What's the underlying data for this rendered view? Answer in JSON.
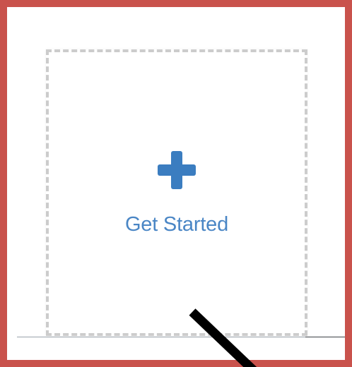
{
  "card": {
    "label": "Get Started",
    "icon": "plus-icon"
  },
  "colors": {
    "highlight_frame": "#c9524c",
    "accent": "#3b7dc0",
    "label": "#4a86c5",
    "dashed_border": "#cccccc",
    "pointer": "#000000"
  }
}
